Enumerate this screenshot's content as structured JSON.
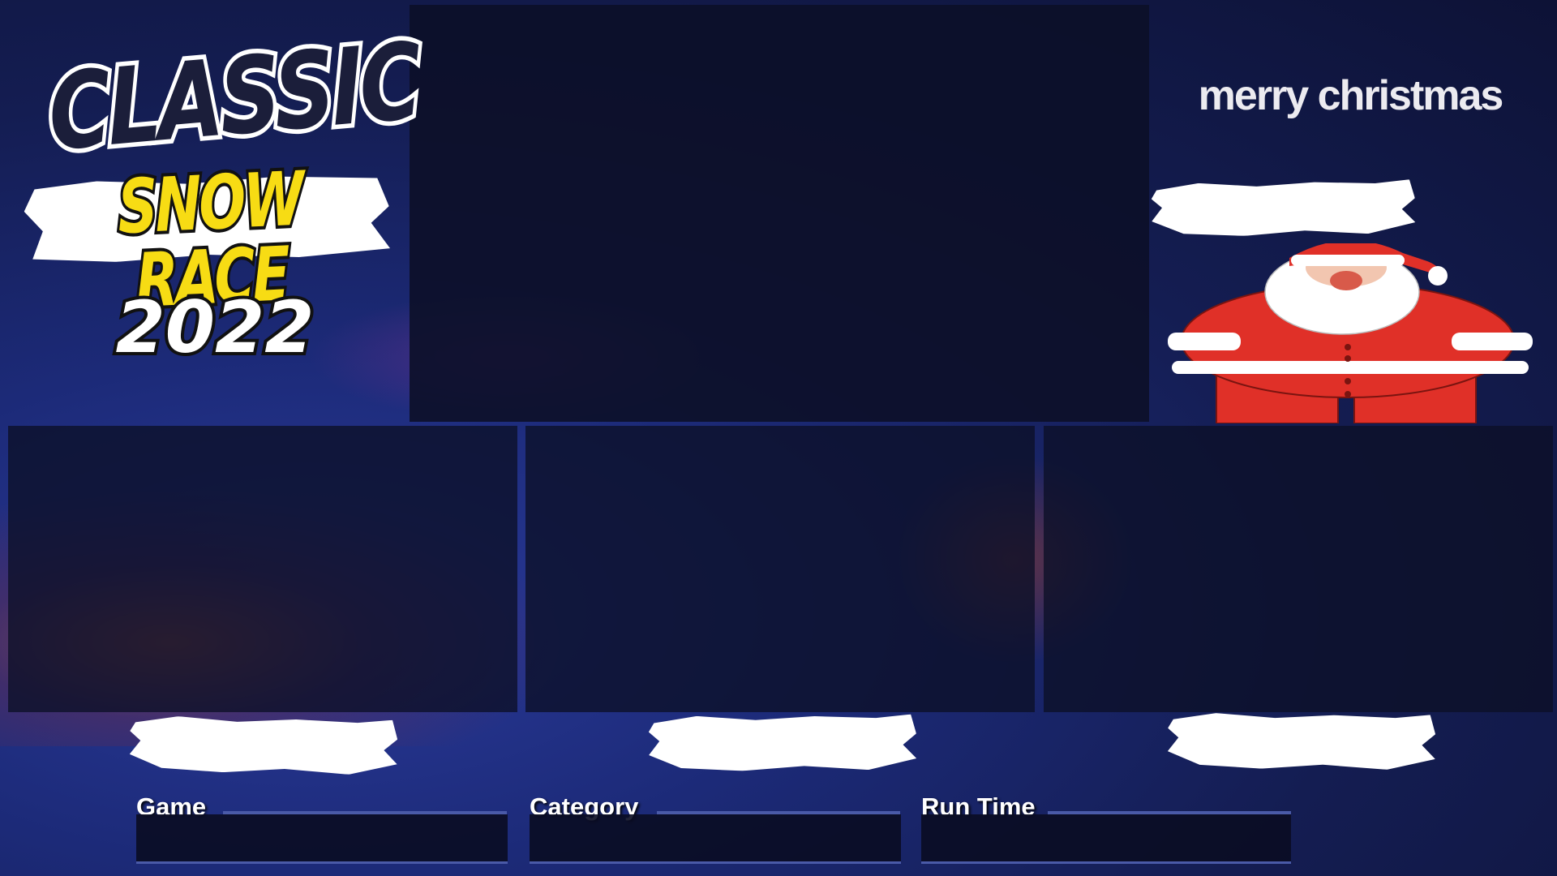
{
  "logo": {
    "line1": "CLASSIC",
    "line2": "SNOW RACE",
    "line3": "2022"
  },
  "greeting": "merry christmas",
  "info": {
    "game_label": "Game",
    "category_label": "Category",
    "runtime_label": "Run Time"
  },
  "colors": {
    "background": "#1c2a78",
    "logo_yellow": "#f7dc14",
    "santa_red": "#e03028"
  }
}
